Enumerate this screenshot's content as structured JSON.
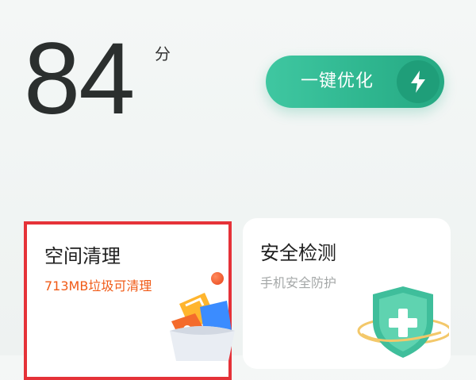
{
  "score": {
    "value": "84",
    "unit": "分"
  },
  "optimize_button": {
    "label": "一键优化",
    "icon": "bolt-icon"
  },
  "cards": {
    "clean": {
      "title": "空间清理",
      "subtitle": "713MB垃圾可清理",
      "highlighted": true
    },
    "security": {
      "title": "安全检测",
      "subtitle": "手机安全防护"
    }
  },
  "colors": {
    "accent_green": "#2eb58e",
    "warning_orange": "#f05a16",
    "highlight_red": "#e53238"
  }
}
